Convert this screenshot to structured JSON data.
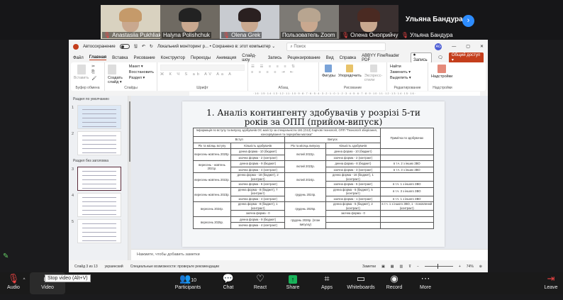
{
  "participants": [
    {
      "name": "Anastasiia Pukhliak",
      "muted": true,
      "active": false
    },
    {
      "name": "Halyna Polishchuk",
      "muted": false,
      "active": true
    },
    {
      "name": "Olena Grek",
      "muted": true,
      "active": false
    },
    {
      "name": "Пользователь Zoom",
      "muted": false,
      "active": false
    },
    {
      "name": "Олена Оноприйчук",
      "muted": true,
      "active": false
    },
    {
      "name": "Ульяна Бандура",
      "muted": true,
      "active": false
    }
  ],
  "speaker_name": "Ульяна Бандура",
  "ppt": {
    "autosave": "Автосохранение",
    "doc_title": "Локальний моніторинг р... • Сохранено в: этот компьютер ⌄",
    "search_placeholder": "Поиск",
    "avatar": "AG",
    "menu": [
      "Файл",
      "Главная",
      "Вставка",
      "Рисование",
      "Конструктор",
      "Переходы",
      "Анимация",
      "Слайд-шоу",
      "Запись",
      "Рецензирование",
      "Вид",
      "Справка",
      "ABBYY FineReader PDF"
    ],
    "record": "⏺ Запись",
    "share": "Общий доступ ▾",
    "ribbon": {
      "clipboard": "Буфер обмена",
      "paste": "Вставить",
      "slides": "Слайды",
      "new_slide": "Создать слайд ▾",
      "layout": "Макет ▾",
      "reset": "Восстановить",
      "section": "Раздел ▾",
      "font": "Шрифт",
      "paragraph": "Абзац",
      "drawing": "Рисование",
      "shapes": "Фигуры",
      "arrange": "Упорядочить",
      "styles": "Экспресс-стили",
      "editing": "Редактирование",
      "find": "Найти",
      "replace": "Заменить ▾",
      "select": "Выделить ▾",
      "addins": "Надстройки",
      "addins_btn": "Надстройки"
    },
    "ruler": "·16·15·14·13·12·11·10·9·8·7·6·5·4·3·2·1·0·1·2·3·4·5·6·7·8·9·10·11·12·13·14·15·16·",
    "sections": [
      "Раздел по умолчанию",
      "Раздел без заголовка"
    ],
    "thumb_numbers": [
      "1",
      "2",
      "3",
      "4",
      "5"
    ],
    "notes_placeholder": "Нажмите, чтобы добавить заметки",
    "status": {
      "slide": "Слайд 3 из 13",
      "lang": "украинский",
      "access": "Специальные возможности: проверьте рекомендации",
      "notes": "Заметки",
      "zoom": "74%"
    }
  },
  "slide": {
    "title": "1. Аналіз контингенту здобувачів у розрізі 5-ти років за ОПП (прийом-випуск)",
    "table": {
      "info": "Інформація по вступу та випуску здобувачів ОС магістр за спеціальністю 181 (G13) Харчові технології, ОПП \"Технології зберігання, консервування та переробки молока\"",
      "note_header": "Примітка по здобувачах",
      "entry": "Вступ",
      "exit": "Випуск",
      "col_entry_date": "Рік та місяць вступу",
      "col_count": "Кількість здобувачів",
      "col_exit_date": "Рік та місяць випуску",
      "groups": [
        {
          "entry": "вересень-жовтень 2020р.",
          "exit": "лютий 2022р.",
          "rows": [
            {
              "in": "денна форма - 10 (бюджет)",
              "out": "денна форма - 10 (бюджет)",
              "note": ""
            },
            {
              "in": "заочна форма - 2 (контракт)",
              "out": "заочна форма - 2 (контракт)",
              "note": ""
            }
          ]
        },
        {
          "entry": "вересень - жовтень 2021р.",
          "exit": "лютий 2023р.",
          "rows": [
            {
              "in": "денна форма - 9 (бюджет)",
              "out": "денна форма - 8 (бюджет)",
              "note": "в т.ч. 2 з інших ЗВО"
            },
            {
              "in": "заочна форма - 4 (контракт)",
              "out": "заочна форма - 3 (контракт)",
              "note": "в т.ч. 3 з інших ЗВО"
            }
          ]
        },
        {
          "entry": "вересень-жовтень 2022р.",
          "exit": "лютий 2024р.",
          "rows": [
            {
              "in": "денна форма - 18 (бюджет), 2 (контракт)",
              "out": "денна форма - 16 (бюджет), 1 (контракт)",
              "note": ""
            },
            {
              "in": "заочна форма - 6 (контракт)",
              "out": "заочна форма - 5 (контракт)",
              "note": "в т.ч. 1 з іншого ЗВО"
            }
          ]
        },
        {
          "entry": "вересень-жовтень 2023р.",
          "exit": "грудень 2024р.",
          "rows": [
            {
              "in": "денна форма - 8 (бюджет), 7 (контракт)",
              "out": "денна форма - 6 (бюджет), 5 (контракт)",
              "note": "в т.ч. 3 з іншого ЗВО"
            },
            {
              "in": "заочна форма - 4 (контракт)",
              "out": "заочна форма - 1 (контракт)",
              "note": "в т.ч. 1 з іншого ЗВО"
            }
          ]
        },
        {
          "entry": "вересень 2024р.",
          "exit": "грудень 2025р.",
          "rows": [
            {
              "in": "денна форма - 8 (бюджет), 1 (контракт)",
              "out": "денна форма - 5 (бюджет), 2 (контракт)",
              "note": "в т.ч. 1 з іншого ЗВО, 1 - поновлений (контракт)"
            },
            {
              "in": "заочна форма - 0",
              "out": "заочна форма - 0",
              "note": ""
            }
          ]
        },
        {
          "entry": "вересень 2025р.",
          "exit": "грудень 2026р. (план випуску)",
          "rows": [
            {
              "in": "денна форма - 9 (бюджет)",
              "out": "",
              "note": ""
            },
            {
              "in": "заочна форма - 4 (контракт)",
              "out": "",
              "note": ""
            }
          ]
        }
      ]
    }
  },
  "toolbar": {
    "audio": "Audio",
    "video": "Video",
    "tooltip": "Stop video (Alt+V)",
    "participants": "Participants",
    "participants_count": "10",
    "chat": "Chat",
    "react": "React",
    "share": "Share",
    "apps": "Apps",
    "whiteboards": "Whiteboards",
    "record": "Record",
    "more": "More",
    "leave": "Leave"
  }
}
